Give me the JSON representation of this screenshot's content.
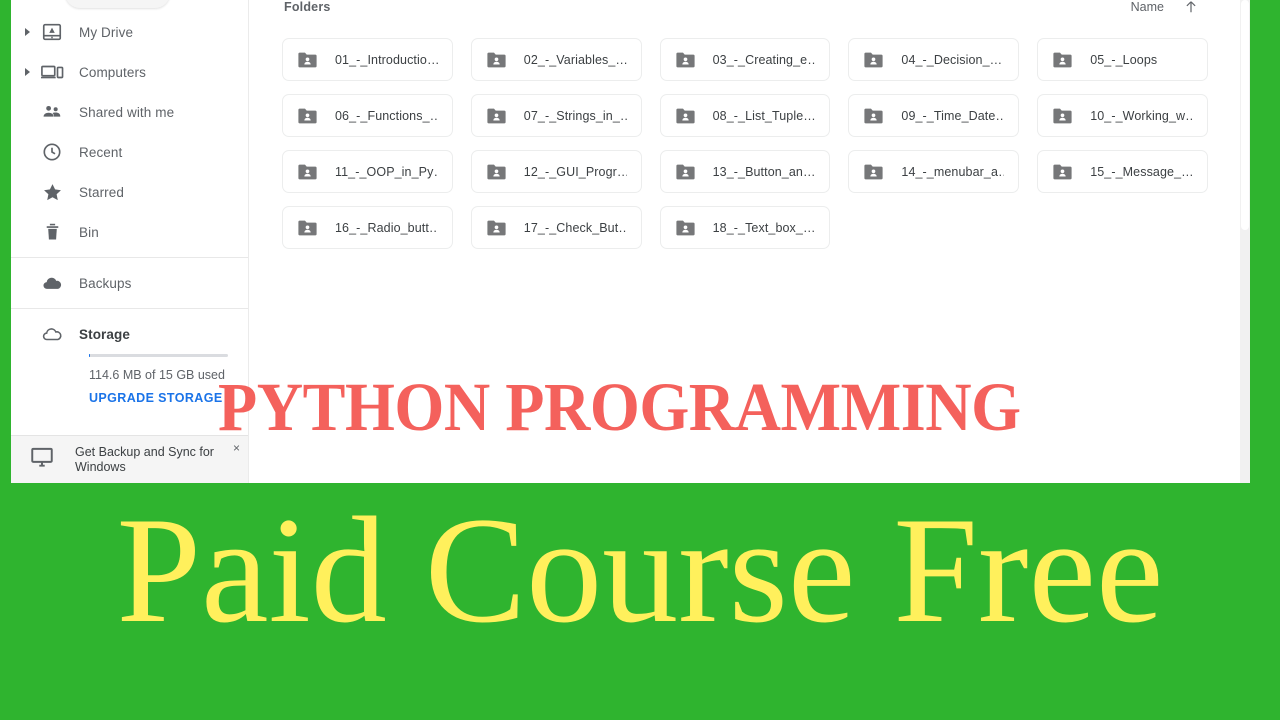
{
  "colors": {
    "brand_green": "#2fb42f",
    "title_red": "#f4615c",
    "subtitle_yellow": "#fff05c",
    "link_blue": "#1a73e8"
  },
  "sidebar": {
    "items": [
      {
        "label": "My Drive",
        "icon": "drive-icon",
        "expandable": true
      },
      {
        "label": "Computers",
        "icon": "computer-icon",
        "expandable": true
      },
      {
        "label": "Shared with me",
        "icon": "people-icon",
        "expandable": false
      },
      {
        "label": "Recent",
        "icon": "clock-icon",
        "expandable": false
      },
      {
        "label": "Starred",
        "icon": "star-icon",
        "expandable": false
      },
      {
        "label": "Bin",
        "icon": "trash-icon",
        "expandable": false
      },
      {
        "label": "Backups",
        "icon": "cloud-filled-icon",
        "expandable": false
      }
    ],
    "storage": {
      "label": "Storage",
      "icon": "cloud-outline-icon",
      "used_text": "114.6 MB of 15 GB used",
      "upgrade_label": "UPGRADE STORAGE",
      "used_percent": 0.75
    },
    "promo": {
      "icon": "monitor-icon",
      "text": "Get Backup and Sync for Windows",
      "close_label": "×"
    }
  },
  "main": {
    "section_label": "Folders",
    "sort": {
      "label": "Name",
      "direction_icon": "arrow-up-icon"
    },
    "folders": [
      {
        "name": "01_-_Introductio…"
      },
      {
        "name": "02_-_Variables_…"
      },
      {
        "name": "03_-_Creating_e…"
      },
      {
        "name": "04_-_Decision_…"
      },
      {
        "name": "05_-_Loops"
      },
      {
        "name": "06_-_Functions_…"
      },
      {
        "name": "07_-_Strings_in_…"
      },
      {
        "name": "08_-_List_Tuple…"
      },
      {
        "name": "09_-_Time_Date…"
      },
      {
        "name": "10_-_Working_w…"
      },
      {
        "name": "11_-_OOP_in_Py…"
      },
      {
        "name": "12_-_GUI_Progr…"
      },
      {
        "name": "13_-_Button_an…"
      },
      {
        "name": "14_-_menubar_a…"
      },
      {
        "name": "15_-_Message_…"
      },
      {
        "name": "16_-_Radio_butt…"
      },
      {
        "name": "17_-_Check_But…"
      },
      {
        "name": "18_-_Text_box_…"
      }
    ]
  },
  "overlay": {
    "title": "PYTHON PROGRAMMING",
    "subtitle": "Paid Course Free"
  }
}
